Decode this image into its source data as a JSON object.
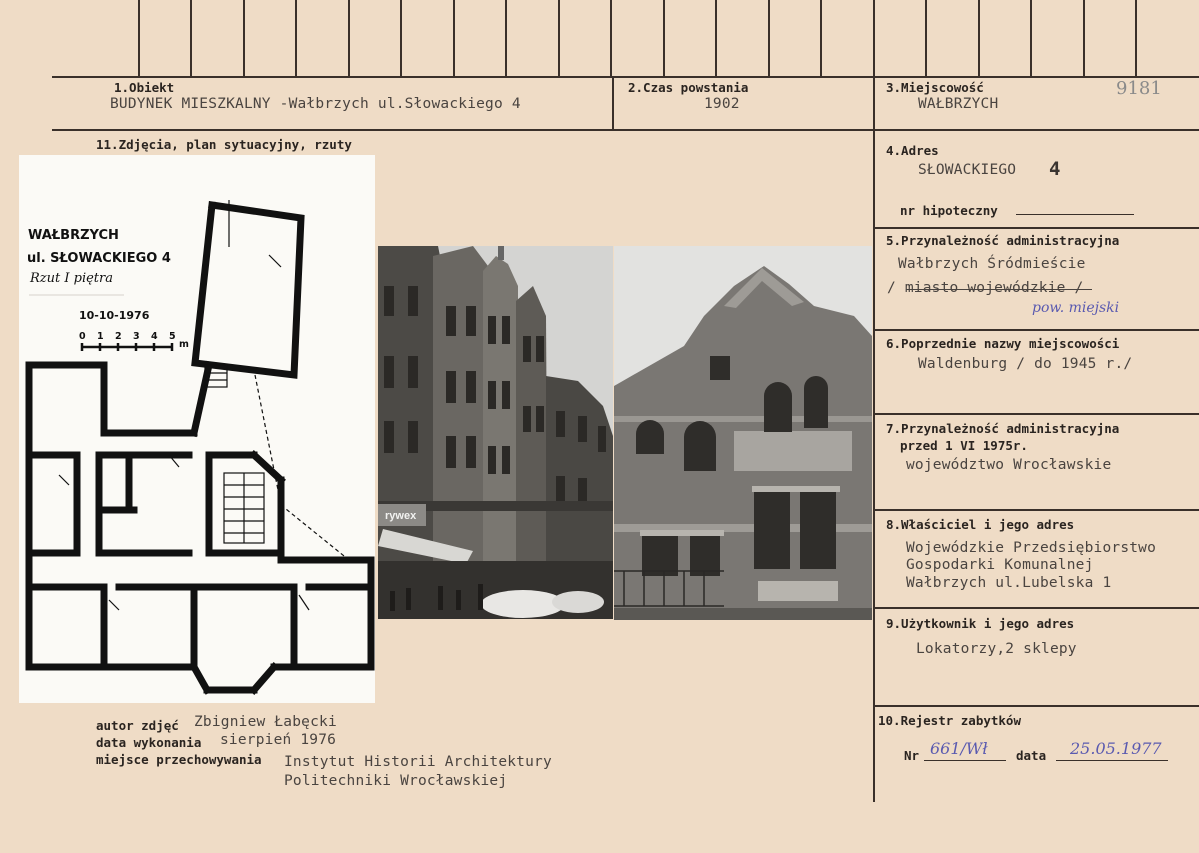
{
  "fields": {
    "f1": {
      "label": "1.Obiekt",
      "value": "BUDYNEK MIESZKALNY -Wałbrzych ul.Słowackiego 4"
    },
    "f2": {
      "label": "2.Czas powstania",
      "value": "1902"
    },
    "f3": {
      "label": "3.Miejscowość",
      "value": "WAŁBRZYCH"
    },
    "catalog_no": "9181",
    "f11": {
      "label": "11.Zdjęcia, plan sytuacyjny, rzuty"
    },
    "f4": {
      "label": "4.Adres",
      "value": "SŁOWACKIEGO",
      "number": "4"
    },
    "hipoteczny": {
      "label": "nr hipoteczny"
    },
    "f5": {
      "label": "5.Przynależność administracyjna",
      "value1": "Wałbrzych Śródmieście",
      "value2": "/ miasto wojewódzkie /",
      "note": "pow. miejski"
    },
    "f6": {
      "label": "6.Poprzednie nazwy miejscowości",
      "value": "Waldenburg / do 1945 r./"
    },
    "f7": {
      "label1": "7.Przynależność administracyjna",
      "label2": "przed 1 VI 1975r.",
      "value": "województwo Wrocławskie"
    },
    "f8": {
      "label": "8.Właściciel i jego adres",
      "lines": [
        "Wojewódzkie Przedsiębiorstwo",
        "Gospodarki Komunalnej",
        "Wałbrzych ul.Lubelska 1"
      ]
    },
    "f9": {
      "label": "9.Użytkownik i jego adres",
      "value": "Lokatorzy,2 sklepy"
    },
    "f10": {
      "label": "10.Rejestr zabytków",
      "nr_label": "Nr",
      "nr_value": "661/Wł",
      "data_label": "data",
      "data_value": "25.05.1977"
    },
    "footer": {
      "autor_label": "autor zdjęć",
      "autor_value": "Zbigniew Łabęcki",
      "data_label": "data wykonania",
      "data_value": "sierpień 1976",
      "miejsce_label": "miejsce przechowywania",
      "miejsce_value1": "Instytut Historii Architektury",
      "miejsce_value2": "Politechniki Wrocławskiej"
    },
    "plan": {
      "city": "WAŁBRZYCH",
      "street": "ul. SŁOWACKIEGO 4",
      "subtitle": "Rzut I piętra",
      "date": "10-10-1976",
      "scale_nums": [
        "0",
        "1",
        "2",
        "3",
        "4",
        "5"
      ],
      "scale_unit": "m"
    },
    "photo_sign": "rywex"
  }
}
